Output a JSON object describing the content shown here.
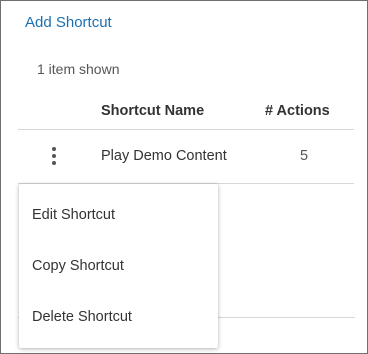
{
  "toolbar": {
    "add_shortcut_label": "Add Shortcut"
  },
  "list": {
    "count_text": "1 item shown"
  },
  "table": {
    "columns": [
      "Shortcut Name",
      "# Actions"
    ],
    "rows": [
      {
        "name": "Play Demo Content",
        "actions": "5",
        "row_menu_icon": "vertical-ellipsis-icon"
      }
    ]
  },
  "context_menu": {
    "items": [
      {
        "label": "Edit Shortcut"
      },
      {
        "label": "Copy Shortcut"
      },
      {
        "label": "Delete Shortcut"
      }
    ]
  },
  "colors": {
    "link": "#1b6fb0",
    "text": "#333333",
    "muted": "#555555",
    "divider": "#d8d8d8"
  }
}
